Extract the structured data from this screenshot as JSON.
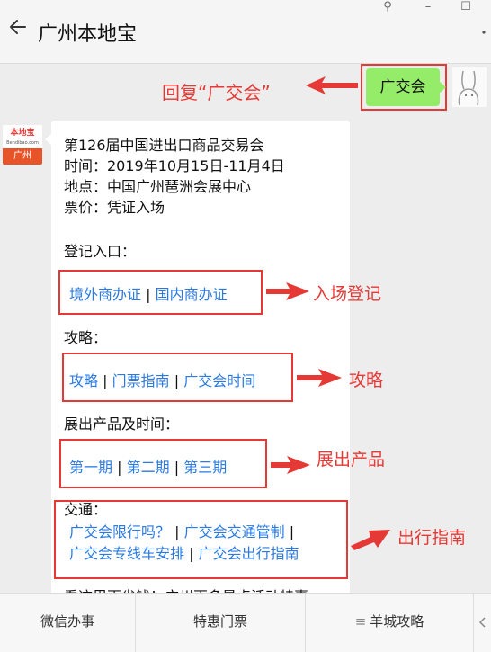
{
  "window": {
    "pin_glyph": "⚲",
    "minimize_glyph": "–",
    "maximize_glyph": "☐"
  },
  "header": {
    "title": "广州本地宝"
  },
  "chat": {
    "user_message": "广交会",
    "reply_annotation": "回复“广交会”",
    "bot_avatar": {
      "brand": "本地宝",
      "url": "Bendibao.com",
      "city": "广州"
    },
    "info": {
      "line1": "第126届中国进出口商品交易会",
      "line2": "时间：2019年10月15日-11月4日",
      "line3": "地点：中国广州琶洲会展中心",
      "line4": "票价：凭证入场"
    },
    "registration": {
      "heading": "登记入口：",
      "link1": "境外商办证",
      "link2": "国内商办证",
      "annotation": "入场登记"
    },
    "guide": {
      "heading": "攻略：",
      "link1": "攻略",
      "link2": "门票指南",
      "link3": "广交会时间",
      "annotation": "攻略"
    },
    "products": {
      "heading": "展出产品及时间：",
      "link1": "第一期",
      "link2": "第二期",
      "link3": "第三期",
      "annotation": "展出产品"
    },
    "transport": {
      "heading": "交通：",
      "link1": "广交会限行吗？",
      "link2": "广交会交通管制",
      "link3": "广交会专线车安排",
      "link4": "广交会出行指南",
      "annotation": "出行指南"
    },
    "sep": "|",
    "cut_off_line": "看这里更省钱！广州更多景点活动特惠"
  },
  "bottom_menu": {
    "item1": "微信办事",
    "item2": "特惠门票",
    "item3": "羊城攻略",
    "menu_glyph": "≡"
  },
  "colors": {
    "accent_red": "#e53935",
    "link_blue": "#2a7ae2",
    "bubble_green": "#95ec69"
  }
}
